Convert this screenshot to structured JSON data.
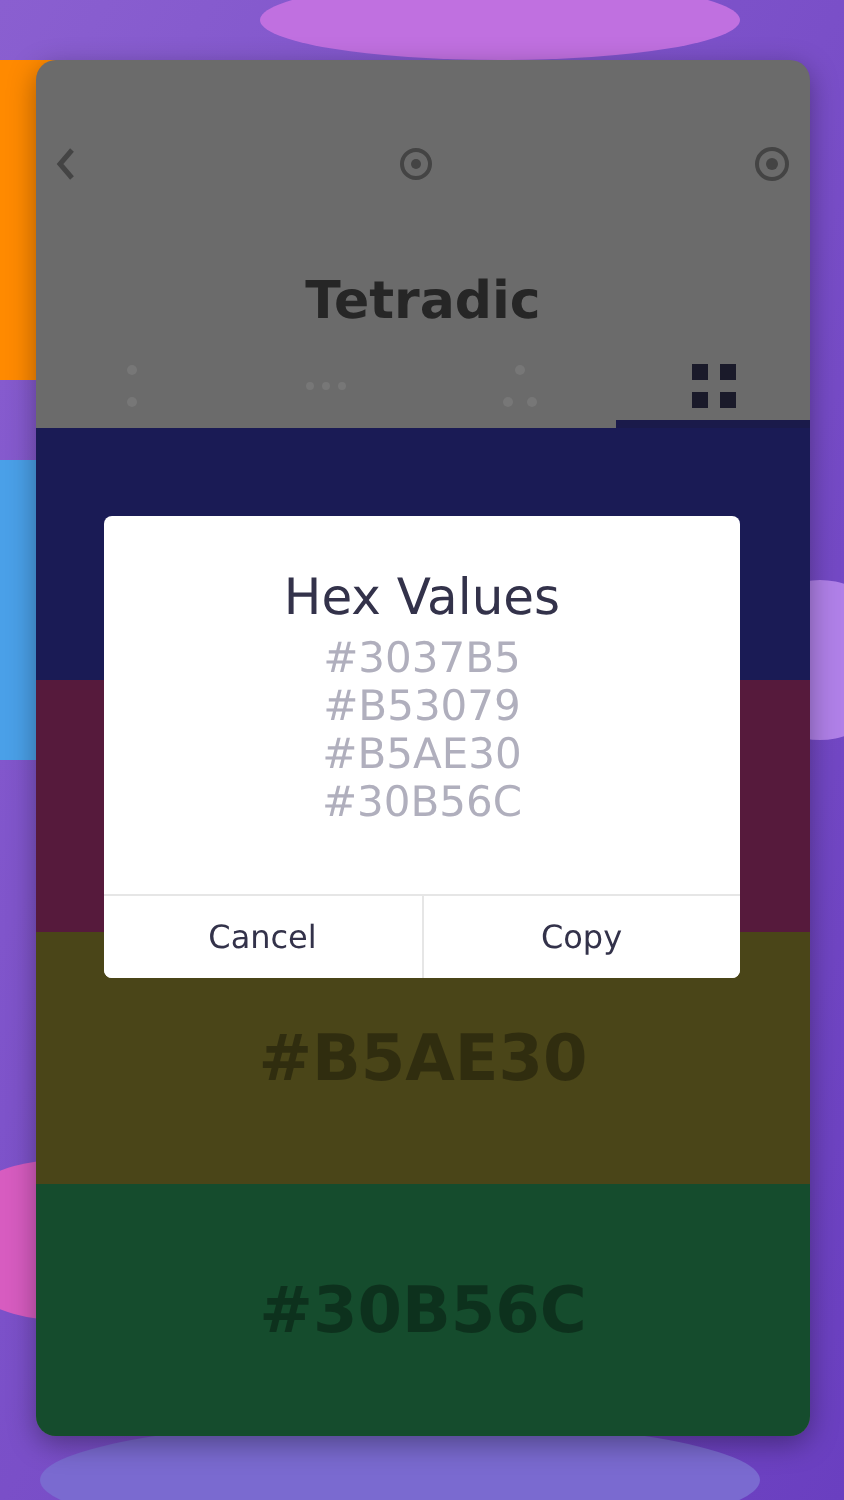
{
  "screen": {
    "title": "Tetradic"
  },
  "tabs": [
    {
      "selected": false
    },
    {
      "selected": false
    },
    {
      "selected": false
    },
    {
      "selected": true
    }
  ],
  "swatches": [
    {
      "color": "#1a1b55"
    },
    {
      "color": "#561a3c"
    },
    {
      "color": "#4a4518",
      "label": "#B5AE30"
    },
    {
      "color": "#154c2d",
      "label": "#30B56C"
    }
  ],
  "dialog": {
    "title": "Hex Values",
    "values": [
      "#3037B5",
      "#B53079",
      "#B5AE30",
      "#30B56C"
    ],
    "buttons": [
      "Cancel",
      "Copy"
    ]
  }
}
